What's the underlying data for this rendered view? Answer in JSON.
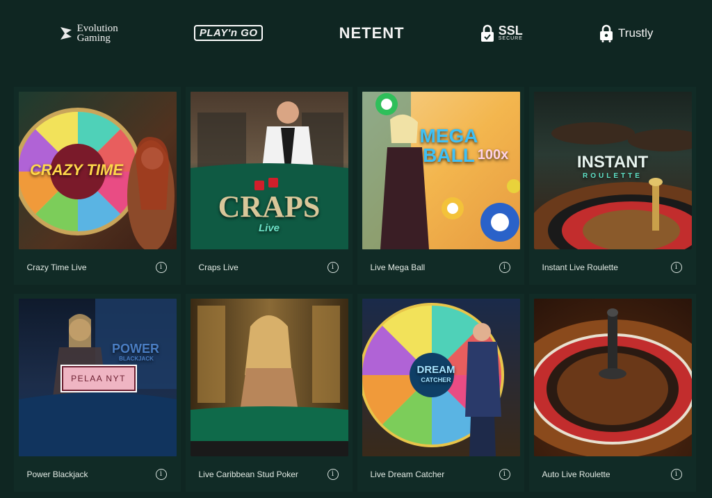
{
  "partners": [
    {
      "name": "Evolution",
      "name2": "Gaming",
      "icon": "evolution-logo-icon"
    },
    {
      "name": "PLAY'n GO",
      "icon": "playngo-logo-icon"
    },
    {
      "name": "NETENT",
      "icon": "netent-logo-icon"
    },
    {
      "name": "SSL",
      "sub": "SECURE",
      "icon": "padlock-icon"
    },
    {
      "name": "Trustly",
      "icon": "trustly-lock-icon"
    }
  ],
  "games": [
    {
      "name": "Crazy Time Live",
      "art_title": "CRAZY TIME"
    },
    {
      "name": "Craps Live",
      "art_title": "CRAPS",
      "art_sub": "Live"
    },
    {
      "name": "Live Mega Ball",
      "art_title": "MEGA BALL",
      "art_badge": "100x"
    },
    {
      "name": "Instant Live Roulette",
      "art_title": "INSTANT",
      "art_sub": "ROULETTE"
    },
    {
      "name": "Power Blackjack",
      "art_title": "POWER",
      "art_sub": "BLACKJACK"
    },
    {
      "name": "Live Caribbean Stud Poker"
    },
    {
      "name": "Live Dream Catcher",
      "art_title": "DREAM",
      "art_sub": "CATCHER"
    },
    {
      "name": "Auto Live Roulette"
    }
  ],
  "play_button_label": "PELAA NYT",
  "info_icon": "info-icon",
  "colors": {
    "background": "#0f2622",
    "card": "#112b26",
    "play_button": "#efb5c3"
  }
}
